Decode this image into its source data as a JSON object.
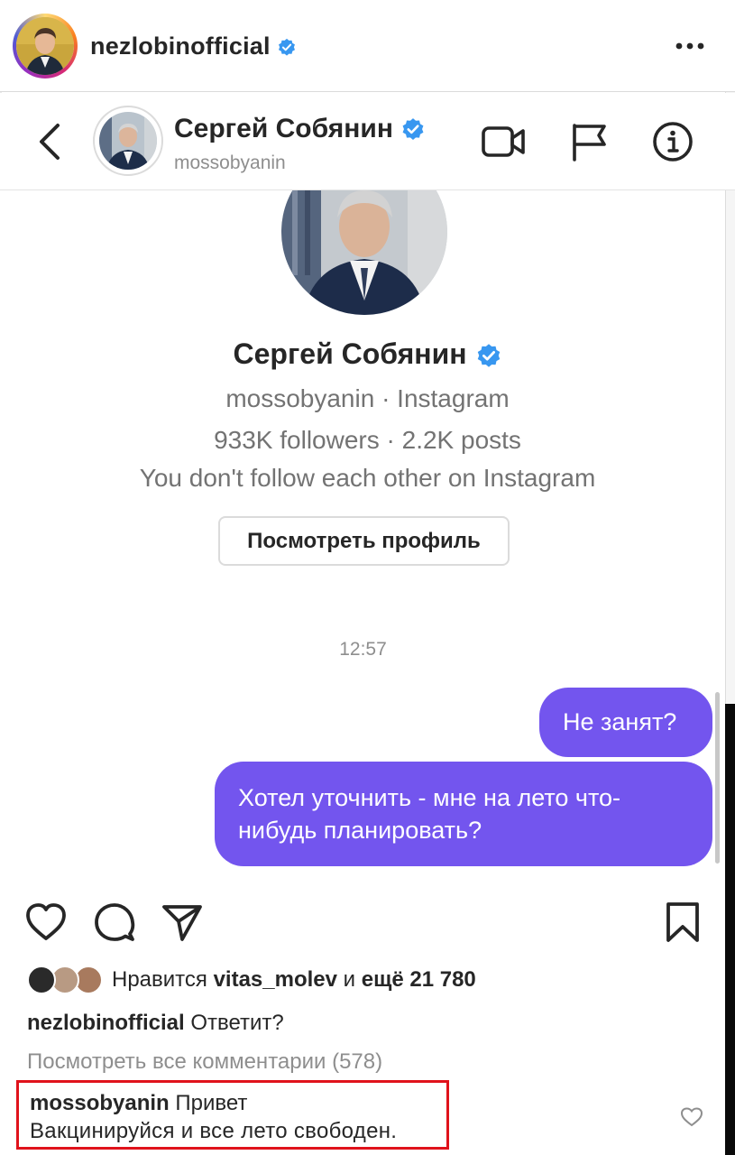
{
  "post": {
    "username": "nezlobinofficial",
    "verified": true
  },
  "dm_header": {
    "name": "Сергей Собянин",
    "handle": "mossobyanin",
    "verified": true
  },
  "profile_card": {
    "name": "Сергей Собянин",
    "subtitle": "mossobyanin · Instagram",
    "stats": "933K followers · 2.2K posts",
    "follow_status": "You don't follow each other on Instagram",
    "view_profile_label": "Посмотреть профиль"
  },
  "messages": {
    "timestamp": "12:57",
    "items": [
      {
        "text": "Не занят?"
      },
      {
        "text": "Хотел уточнить - мне на лето что-нибудь планировать?"
      }
    ]
  },
  "likes": {
    "prefix": "Нравится",
    "user": "vitas_molev",
    "middle": "и",
    "more": "ещё 21 780"
  },
  "caption": {
    "user": "nezlobinofficial",
    "text": "Ответит?"
  },
  "view_comments": "Посмотреть все комментарии (578)",
  "highlighted_comment": {
    "user": "mossobyanin",
    "text_line1": "Привет",
    "text_line2": "Вакцинируйся и все лето свободен."
  },
  "colors": {
    "bubble": "#7355ee",
    "verified": "#3897f0",
    "highlight_border": "#e0121b"
  },
  "icons": {
    "verified": "verified-badge-icon",
    "more": "more-horizontal-icon",
    "back": "chevron-left-icon",
    "video": "video-camera-icon",
    "flag": "flag-icon",
    "info": "info-icon",
    "like": "heart-icon",
    "comment": "comment-icon",
    "share": "send-icon",
    "save": "bookmark-icon"
  }
}
